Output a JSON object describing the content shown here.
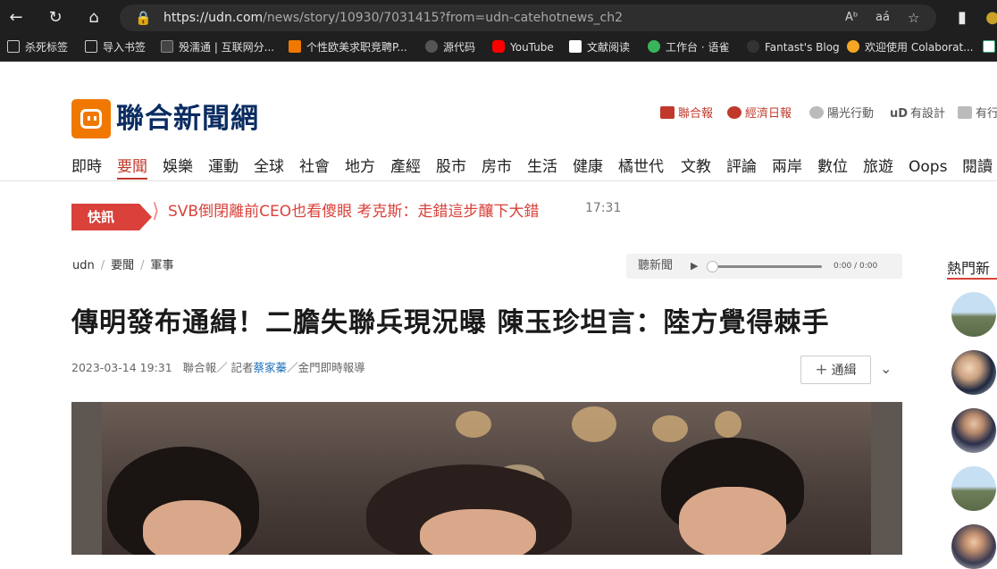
{
  "browser": {
    "url_host": "https://udn.com",
    "url_path": "/news/story/10930/7031415?from=udn-catehotnews_ch2"
  },
  "bookmarks": [
    {
      "label": "杀死标签",
      "color": "#e0e0e0"
    },
    {
      "label": "导入书签",
      "color": "#e0e0e0"
    },
    {
      "label": "殁濡通 | 互联网分...",
      "color": "#555555"
    },
    {
      "label": "个性欧美求职竞聘P...",
      "color": "#f07800"
    },
    {
      "label": "源代码",
      "color": "#666666"
    },
    {
      "label": "YouTube",
      "color": "#ff0000"
    },
    {
      "label": "文献阅读",
      "color": "#ffffff"
    },
    {
      "label": "工作台 · 语雀",
      "color": "#3ab45a"
    },
    {
      "label": "Fantast's Blog",
      "color": "#333333"
    },
    {
      "label": "欢迎使用 Colaborat...",
      "color": "#f5a623"
    }
  ],
  "site": {
    "logo_text": "聯合新聞網",
    "partners": [
      {
        "label": "聯合報",
        "color": "#c0392b"
      },
      {
        "label": "經濟日報",
        "color": "#c0392b"
      },
      {
        "label": "陽光行動",
        "color": "#555555"
      },
      {
        "label": "有設計",
        "color": "#555555"
      },
      {
        "label": "有行",
        "color": "#555555"
      }
    ]
  },
  "nav": [
    "即時",
    "要聞",
    "娛樂",
    "運動",
    "全球",
    "社會",
    "地方",
    "產經",
    "股市",
    "房市",
    "生活",
    "健康",
    "橘世代",
    "文教",
    "評論",
    "兩岸",
    "數位",
    "旅遊",
    "Oops",
    "閱讀"
  ],
  "nav_active": "要聞",
  "flash": {
    "tag": "快訊",
    "text": "SVB倒閉離前CEO也看傻眼 考克斯：走錯這步釀下大錯",
    "time": "17:31"
  },
  "breadcrumb": [
    "udn",
    "要聞",
    "軍事"
  ],
  "audio": {
    "label": "聽新聞",
    "time": "0:00 / 0:00"
  },
  "article": {
    "title": "傳明發布通緝！二膽失聯兵現況曝 陳玉珍坦言：陸方覺得棘手",
    "date": "2023-03-14 19:31",
    "source_prefix": "聯合報／ 記者",
    "reporter": "蔡家蓁",
    "source_suffix": "／金門即時報導",
    "follow_label": "通緝"
  },
  "sidebar": {
    "title": "熱門新"
  },
  "colors": {
    "accent": "#d9413a",
    "brand_orange": "#f07800",
    "brand_navy": "#0a2c61"
  }
}
